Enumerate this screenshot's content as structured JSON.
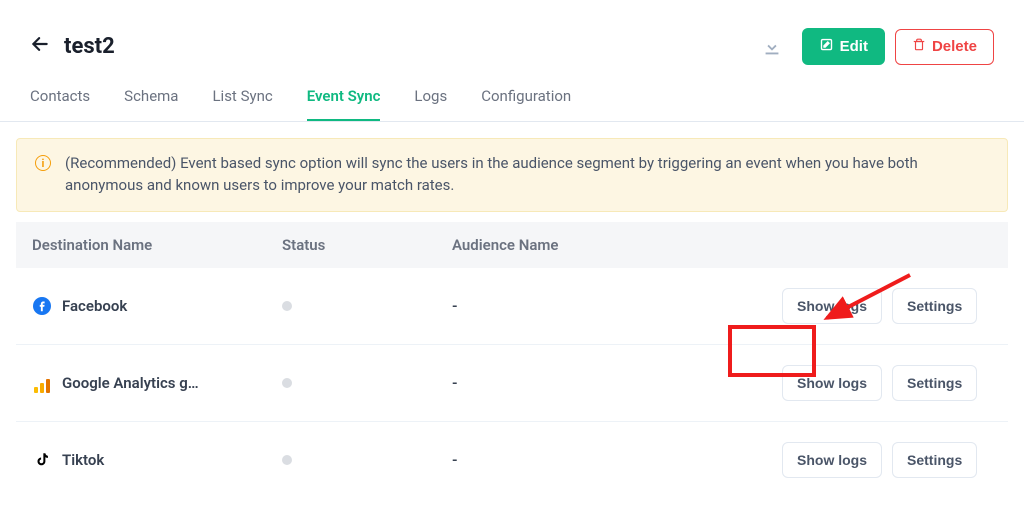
{
  "header": {
    "title": "test2",
    "edit_label": "Edit",
    "delete_label": "Delete"
  },
  "tabs": {
    "contacts": "Contacts",
    "schema": "Schema",
    "list_sync": "List Sync",
    "event_sync": "Event Sync",
    "logs": "Logs",
    "configuration": "Configuration",
    "active": "event_sync"
  },
  "banner": {
    "text": "(Recommended) Event based sync option will sync the users in the audience segment by triggering an event when you have both anonymous and known users to improve your match rates."
  },
  "table": {
    "headers": {
      "destination": "Destination Name",
      "status": "Status",
      "audience": "Audience Name"
    },
    "buttons": {
      "show_logs": "Show logs",
      "settings": "Settings"
    },
    "rows": [
      {
        "icon": "facebook",
        "name": "Facebook",
        "audience": "-"
      },
      {
        "icon": "ga",
        "name": "Google Analytics g…",
        "audience": "-"
      },
      {
        "icon": "tiktok",
        "name": "Tiktok",
        "audience": "-"
      }
    ]
  }
}
